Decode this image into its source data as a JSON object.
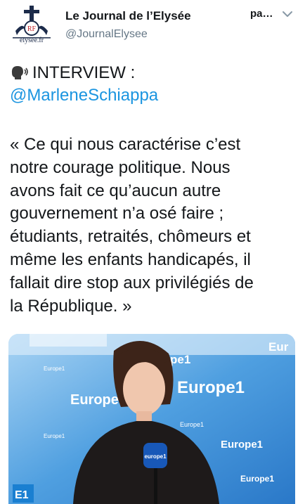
{
  "tweet": {
    "author": {
      "display_name": "Le Journal de l’Elysée",
      "handle": "@JournalElysee",
      "avatar_caption": "elysee.fr"
    },
    "follow_label": "pa…",
    "menu_icon": "chevron-down-icon",
    "headline": "INTERVIEW :",
    "headline_icon": "speaking-head-icon",
    "mention": "@MarleneSchiappa",
    "quote_lines": [
      "« Ce qui nous caractérise c’est",
      "notre courage politique. Nous",
      "avons fait ce qu’aucun autre",
      "gouvernement n’a osé faire ;",
      "étudiants, retraités, chômeurs et",
      "même les enfants handicapés, il",
      "fallait dire stop aux privilégiés de",
      "la République. »"
    ],
    "media": {
      "brand_large": "Europe1",
      "brand_small": "Europe1",
      "brand_partial": "Eur",
      "brand_partial2": "pe1",
      "mic_label": "europe1",
      "corner_logo": "E1"
    }
  },
  "colors": {
    "link": "#1b95e0",
    "secondary_text": "#657786",
    "studio_blue": "#2f88d6",
    "studio_light": "#8cc4ef"
  }
}
